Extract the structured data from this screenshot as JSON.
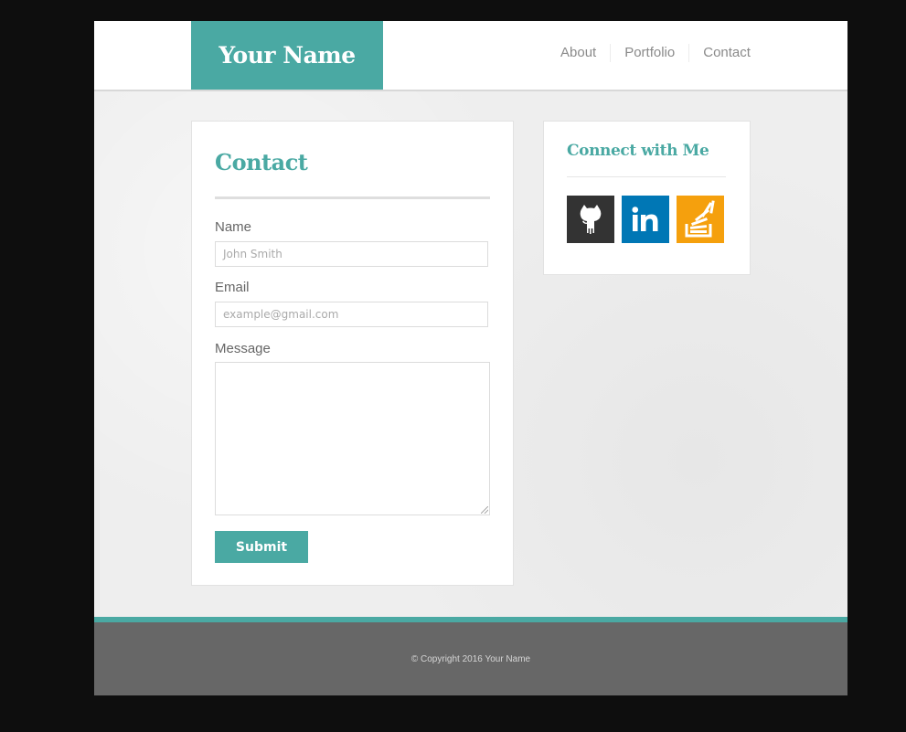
{
  "header": {
    "brand": "Your Name",
    "nav": [
      {
        "label": "About"
      },
      {
        "label": "Portfolio"
      },
      {
        "label": "Contact"
      }
    ]
  },
  "contact_form": {
    "title": "Contact",
    "fields": {
      "name": {
        "label": "Name",
        "placeholder": "John Smith",
        "value": ""
      },
      "email": {
        "label": "Email",
        "placeholder": "example@gmail.com",
        "value": ""
      },
      "message": {
        "label": "Message",
        "value": ""
      }
    },
    "submit_label": "Submit"
  },
  "connect": {
    "title": "Connect with Me",
    "links": [
      {
        "name": "GitHub",
        "icon": "github-icon",
        "color": "#333333"
      },
      {
        "name": "LinkedIn",
        "icon": "linkedin-icon",
        "color": "#0077b5",
        "glyph": "in"
      },
      {
        "name": "Stack Overflow",
        "icon": "stackoverflow-icon",
        "color": "#f5a00d"
      }
    ]
  },
  "colors": {
    "accent": "#4aa9a3",
    "footer": "#676767"
  },
  "footer": {
    "copyright": "© Copyright 2016 Your Name"
  }
}
